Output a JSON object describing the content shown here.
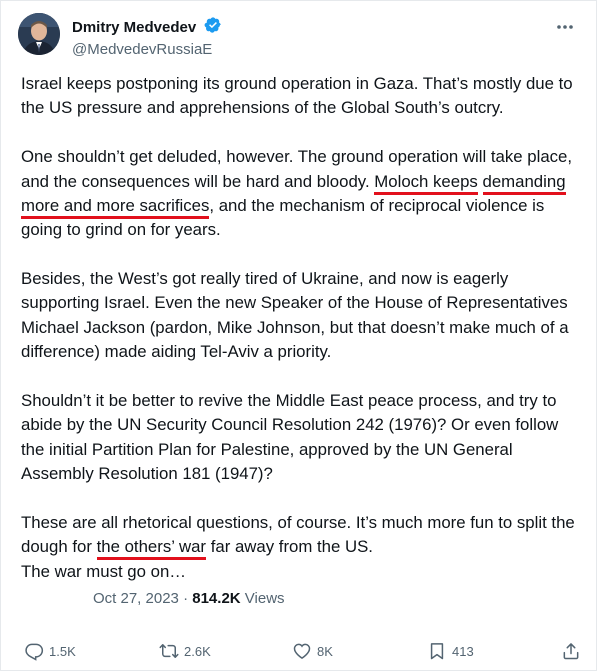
{
  "author": {
    "display_name": "Dmitry Medvedev",
    "handle": "@MedvedevRussiaE",
    "verified": true,
    "avatar_icon": "profile-photo"
  },
  "more_icon": "ellipsis-icon",
  "tweet": {
    "p1": "Israel keeps postponing its ground operation in Gaza. That’s mostly due to the US pressure and apprehensions of the Global South’s outcry.",
    "p2_a": "One shouldn’t get deluded, however. The ground operation will take place, and the consequences will be hard and bloody. ",
    "p2_hl1": "Moloch keeps",
    "p2_sp": " ",
    "p2_hl2": "demanding more and more sacrifices",
    "p2_b": ", and the mechanism of reciprocal violence is going to grind on for years.",
    "p3": "Besides, the West’s got really tired of Ukraine, and now is eagerly supporting Israel. Even the new Speaker of the House of Representatives Michael Jackson (pardon, Mike Johnson, but that doesn’t make much of a difference) made aiding Tel-Aviv a priority.",
    "p4": "Shouldn’t it be better to revive the Middle East peace process, and try to abide by the UN Security Council Resolution 242 (1976)? Or even follow the initial Partition Plan for Palestine, approved by the UN General Assembly Resolution 181 (1947)?",
    "p5_a": "These are all rhetorical questions, of course. It’s much more fun to split the dough for ",
    "p5_hl": "the others’ war",
    "p5_b": " far away from the US.",
    "p5_c": "The war must go on…"
  },
  "meta": {
    "date": "Oct 27, 2023",
    "separator": "·",
    "views_count": "814.2K",
    "views_label": "Views"
  },
  "actions": {
    "replies": "1.5K",
    "reposts": "2.6K",
    "likes": "8K",
    "bookmarks": "413"
  },
  "colors": {
    "underline": "#e2101c",
    "verified": "#1d9bf0",
    "muted": "#536471"
  }
}
